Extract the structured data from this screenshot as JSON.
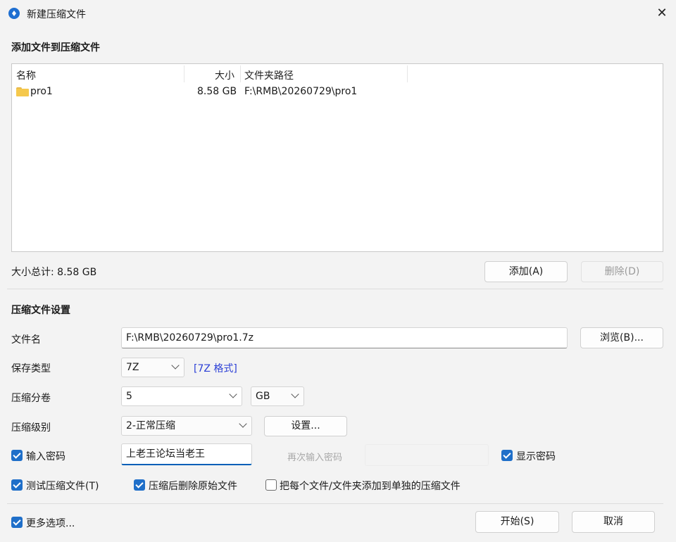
{
  "window": {
    "title": "新建压缩文件",
    "close_glyph": "✕"
  },
  "add_files": {
    "heading": "添加文件到压缩文件",
    "columns": [
      "名称",
      "大小",
      "文件夹路径"
    ],
    "rows": [
      {
        "name": "pro1",
        "size": "8.58 GB",
        "path": "F:\\RMB\\20260729\\pro1"
      }
    ],
    "total_label": "大小总计: 8.58 GB",
    "add_button": "添加(A)",
    "delete_button": "删除(D)"
  },
  "settings": {
    "heading": "压缩文件设置",
    "filename_label": "文件名",
    "filename_value": "F:\\RMB\\20260729\\pro1.7z",
    "browse_button": "浏览(B)...",
    "save_type_label": "保存类型",
    "save_type_value": "7Z",
    "save_type_note": "[7Z 格式]",
    "volume_label": "压缩分卷",
    "volume_value": "5",
    "volume_unit": "GB",
    "level_label": "压缩级别",
    "level_value": "2-正常压缩",
    "config_button": "设置...",
    "password_label": "输入密码",
    "password_value": "上老王论坛当老王",
    "password_confirm_label": "再次输入密码",
    "show_password_label": "显示密码",
    "test_label": "测试压缩文件(T)",
    "delete_after_label": "压缩后删除原始文件",
    "each_separate_label": "把每个文件/文件夹添加到单独的压缩文件"
  },
  "footer": {
    "more_options_label": "更多选项...",
    "start_button": "开始(S)",
    "cancel_button": "取消"
  },
  "checkboxes": {
    "password": true,
    "show_password": true,
    "test": true,
    "delete_after": true,
    "each_separate": false,
    "more_options": true
  },
  "colors": {
    "accent": "#1f6fc9",
    "link": "#2b3fd6",
    "folder": "#f5c84c"
  }
}
